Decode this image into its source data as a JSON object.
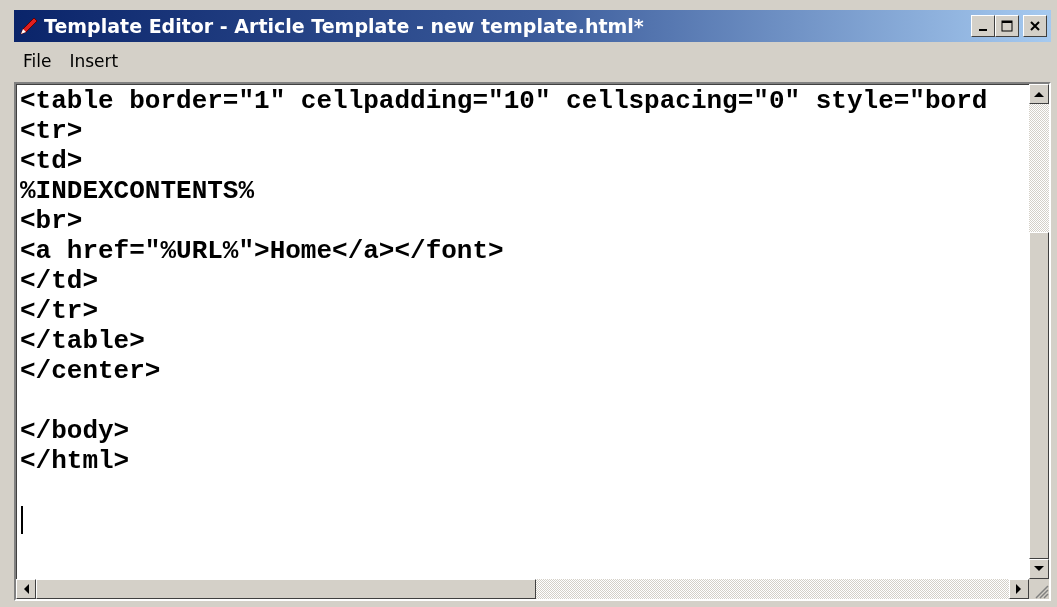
{
  "window": {
    "title": "Template Editor - Article Template - new template.html*"
  },
  "menu": [
    {
      "label": "File"
    },
    {
      "label": "Insert"
    }
  ],
  "editor": {
    "lines": [
      {
        "kind": "code",
        "text": "<table border=\"1\" cellpadding=\"10\" cellspacing=\"0\" style=\"bord"
      },
      {
        "kind": "code",
        "text": "<tr>"
      },
      {
        "kind": "code",
        "text": "<td>"
      },
      {
        "kind": "code",
        "text": "%INDEXCONTENTS%"
      },
      {
        "kind": "code",
        "text": "<br>"
      },
      {
        "kind": "code",
        "text": "<a href=\"%URL%\">Home</a></font>"
      },
      {
        "kind": "code",
        "text": "</td>"
      },
      {
        "kind": "code",
        "text": "</tr>"
      },
      {
        "kind": "code",
        "text": "</table>"
      },
      {
        "kind": "code",
        "text": "</center>"
      },
      {
        "kind": "blank"
      },
      {
        "kind": "code",
        "text": "</body>"
      },
      {
        "kind": "code",
        "text": "</html>"
      }
    ]
  }
}
